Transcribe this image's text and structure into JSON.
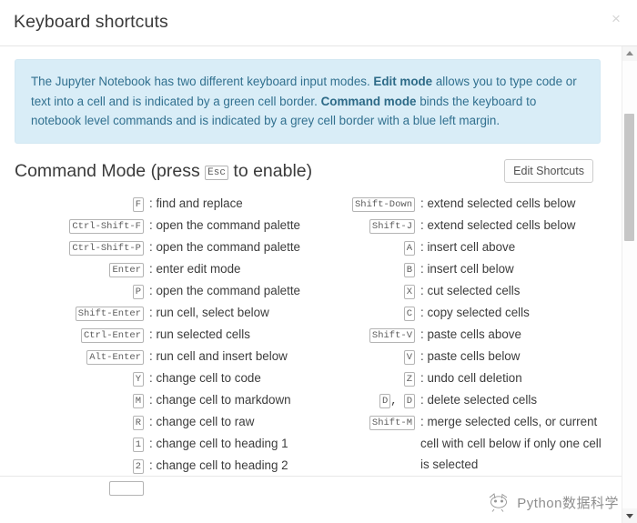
{
  "dialog": {
    "title": "Keyboard shortcuts",
    "close_label": "×"
  },
  "alert": {
    "part1": "The Jupyter Notebook has two different keyboard input modes. ",
    "bold1": "Edit mode",
    "part2": " allows you to type code or text into a cell and is indicated by a green cell border. ",
    "bold2": "Command mode",
    "part3": " binds the keyboard to notebook level commands and is indicated by a grey cell border with a blue left margin."
  },
  "section": {
    "title_prefix": "Command Mode (press ",
    "title_key": "Esc",
    "title_suffix": " to enable)",
    "edit_shortcuts_label": "Edit Shortcuts"
  },
  "shortcuts_left": [
    {
      "keys": [
        "F"
      ],
      "desc": "find and replace"
    },
    {
      "keys": [
        "Ctrl-Shift-F"
      ],
      "desc": "open the command palette"
    },
    {
      "keys": [
        "Ctrl-Shift-P"
      ],
      "desc": "open the command palette"
    },
    {
      "keys": [
        "Enter"
      ],
      "desc": "enter edit mode"
    },
    {
      "keys": [
        "P"
      ],
      "desc": "open the command palette"
    },
    {
      "keys": [
        "Shift-Enter"
      ],
      "desc": "run cell, select below"
    },
    {
      "keys": [
        "Ctrl-Enter"
      ],
      "desc": "run selected cells"
    },
    {
      "keys": [
        "Alt-Enter"
      ],
      "desc": "run cell and insert below"
    },
    {
      "keys": [
        "Y"
      ],
      "desc": "change cell to code"
    },
    {
      "keys": [
        "M"
      ],
      "desc": "change cell to markdown"
    },
    {
      "keys": [
        "R"
      ],
      "desc": "change cell to raw"
    },
    {
      "keys": [
        "1"
      ],
      "desc": "change cell to heading 1"
    },
    {
      "keys": [
        "2"
      ],
      "desc": "change cell to heading 2"
    }
  ],
  "shortcuts_right": [
    {
      "keys": [
        "Shift-Down"
      ],
      "desc": "extend selected cells below"
    },
    {
      "keys": [
        "Shift-J"
      ],
      "desc": "extend selected cells below"
    },
    {
      "keys": [
        "A"
      ],
      "desc": "insert cell above"
    },
    {
      "keys": [
        "B"
      ],
      "desc": "insert cell below"
    },
    {
      "keys": [
        "X"
      ],
      "desc": "cut selected cells"
    },
    {
      "keys": [
        "C"
      ],
      "desc": "copy selected cells"
    },
    {
      "keys": [
        "Shift-V"
      ],
      "desc": "paste cells above"
    },
    {
      "keys": [
        "V"
      ],
      "desc": "paste cells below"
    },
    {
      "keys": [
        "Z"
      ],
      "desc": "undo cell deletion"
    },
    {
      "keys": [
        "D",
        "D"
      ],
      "desc": "delete selected cells"
    },
    {
      "keys": [
        "Shift-M"
      ],
      "desc": "merge selected cells, or current",
      "cont": [
        "cell with cell below if only one cell",
        "is selected"
      ]
    }
  ],
  "scrollbar": {
    "up_arrow": "scroll-up",
    "down_arrow": "scroll-down"
  },
  "watermark": {
    "text": "Python数据科学"
  },
  "colors": {
    "alert_bg": "#d9edf7",
    "alert_text": "#31708f",
    "text": "#3c3c3c",
    "key_border": "#b4b4b4",
    "scroll_thumb": "#c6c6c6"
  }
}
